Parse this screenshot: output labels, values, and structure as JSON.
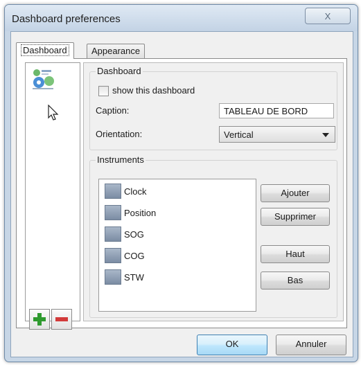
{
  "window": {
    "title": "Dashboard preferences",
    "close_glyph": "X"
  },
  "tabs": [
    {
      "label": "Dashboard",
      "active": true
    },
    {
      "label": "Appearance",
      "active": false
    }
  ],
  "dashboard_list": {
    "icon": "dashboard-icon",
    "add_icon": "plus-icon",
    "remove_icon": "minus-icon"
  },
  "dashboard_group": {
    "title": "Dashboard",
    "show_label": "show this dashboard",
    "show_checked": false,
    "caption_label": "Caption:",
    "caption_value": "TABLEAU DE BORD",
    "orientation_label": "Orientation:",
    "orientation_value": "Vertical"
  },
  "instruments_group": {
    "title": "Instruments",
    "items": [
      "Clock",
      "Position",
      "SOG",
      "COG",
      "STW"
    ],
    "buttons": {
      "add": "Ajouter",
      "remove": "Supprimer",
      "up": "Haut",
      "down": "Bas"
    }
  },
  "footer": {
    "ok": "OK",
    "cancel": "Annuler"
  },
  "colors": {
    "frame": "#c7d6e6",
    "ok_border": "#3c7fb1",
    "add_green": "#2f9a2f",
    "remove_red": "#d23a3a"
  }
}
